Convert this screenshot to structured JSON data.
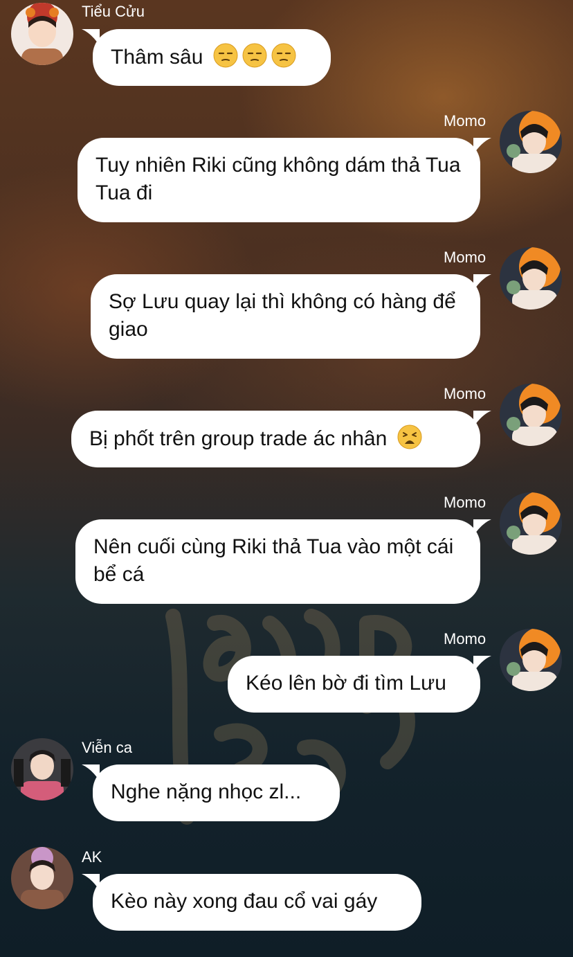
{
  "colors": {
    "bubble": "#ffffff",
    "text": "#111111",
    "name_text": "#ffffff",
    "emoji_face": "#f6c343"
  },
  "messages": [
    {
      "sender": "Tiểu Cửu",
      "side": "left",
      "text": "Thâm sâu",
      "emoji": [
        "unamused-face-icon",
        "unamused-face-icon",
        "unamused-face-icon"
      ]
    },
    {
      "sender": "Momo",
      "side": "right",
      "text": "Tuy nhiên Riki cũng không dám thả Tua Tua đi"
    },
    {
      "sender": "Momo",
      "side": "right",
      "text": "Sợ Lưu quay lại thì không có hàng để giao"
    },
    {
      "sender": "Momo",
      "side": "right",
      "text": "Bị phốt trên group trade ác nhân",
      "emoji": [
        "weary-face-icon"
      ]
    },
    {
      "sender": "Momo",
      "side": "right",
      "text": "Nên cuối cùng Riki thả Tua vào một cái bể cá"
    },
    {
      "sender": "Momo",
      "side": "right",
      "text": "Kéo lên bờ đi tìm Lưu"
    },
    {
      "sender": "Viễn ca",
      "side": "left",
      "text": "Nghe nặng nhọc zl..."
    },
    {
      "sender": "AK",
      "side": "left",
      "text": "Kèo này xong đau cổ vai gáy"
    }
  ]
}
